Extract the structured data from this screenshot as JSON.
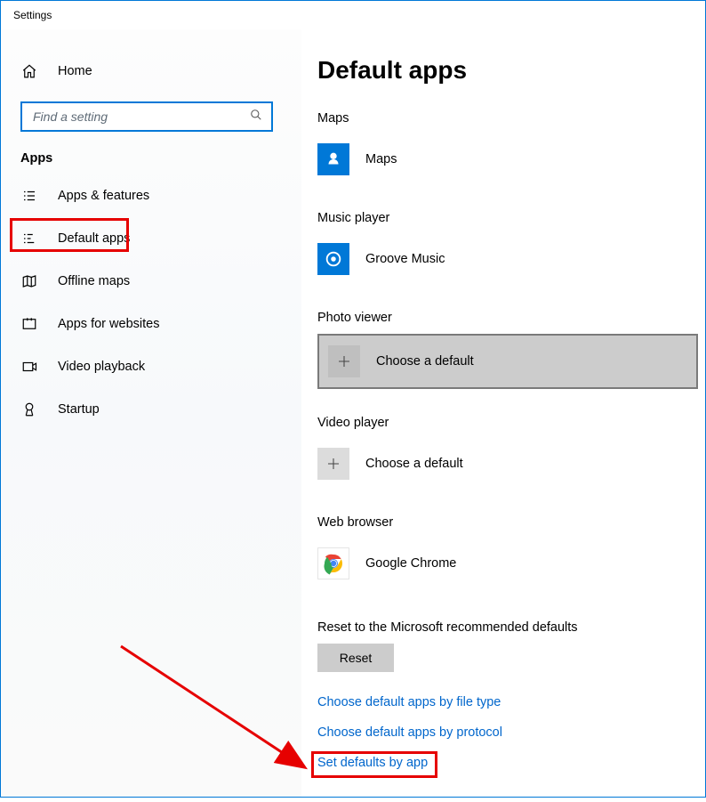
{
  "window": {
    "title": "Settings"
  },
  "sidebar": {
    "home_label": "Home",
    "search_placeholder": "Find a setting",
    "section_label": "Apps",
    "items": [
      {
        "label": "Apps & features"
      },
      {
        "label": "Default apps"
      },
      {
        "label": "Offline maps"
      },
      {
        "label": "Apps for websites"
      },
      {
        "label": "Video playback"
      },
      {
        "label": "Startup"
      }
    ]
  },
  "page_title": "Default apps",
  "categories": {
    "maps": {
      "label": "Maps",
      "app": "Maps"
    },
    "music": {
      "label": "Music player",
      "app": "Groove Music"
    },
    "photo": {
      "label": "Photo viewer",
      "placeholder": "Choose a default"
    },
    "video": {
      "label": "Video player",
      "placeholder": "Choose a default"
    },
    "web": {
      "label": "Web browser",
      "app": "Google Chrome"
    }
  },
  "reset": {
    "label": "Reset to the Microsoft recommended defaults",
    "button": "Reset"
  },
  "links": [
    "Choose default apps by file type",
    "Choose default apps by protocol",
    "Set defaults by app"
  ]
}
